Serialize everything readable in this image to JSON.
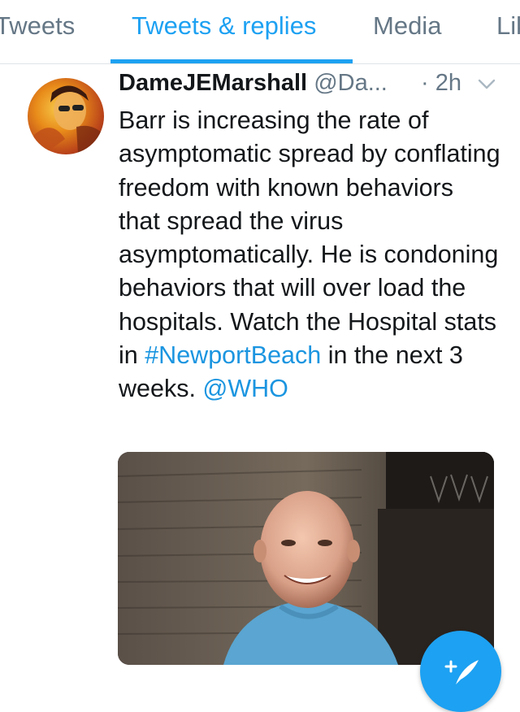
{
  "tabs": [
    {
      "label": "Tweets",
      "active": false
    },
    {
      "label": "Tweets & replies",
      "active": true
    },
    {
      "label": "Media",
      "active": false
    },
    {
      "label": "Likes",
      "active": false
    }
  ],
  "tweet": {
    "author_name": "DameJEMarshall",
    "author_handle": "@Da...",
    "time": "· 2h",
    "text_part1": "Barr is increasing the rate of asymptomatic spread by conflating freedom with known behaviors that spread the virus asymptomatically. He is condoning behaviors that will over load the hospitals. Watch the Hospital stats in ",
    "hashtag": "#NewportBeach",
    "text_part2": " in the next 3 weeks. ",
    "mention": "@WHO"
  },
  "icons": {
    "menu": "chevron-down-icon",
    "compose": "compose-tweet-icon"
  },
  "colors": {
    "accent": "#1da1f2",
    "link": "#1b95e0",
    "text": "#14171a",
    "secondary": "#657786"
  }
}
